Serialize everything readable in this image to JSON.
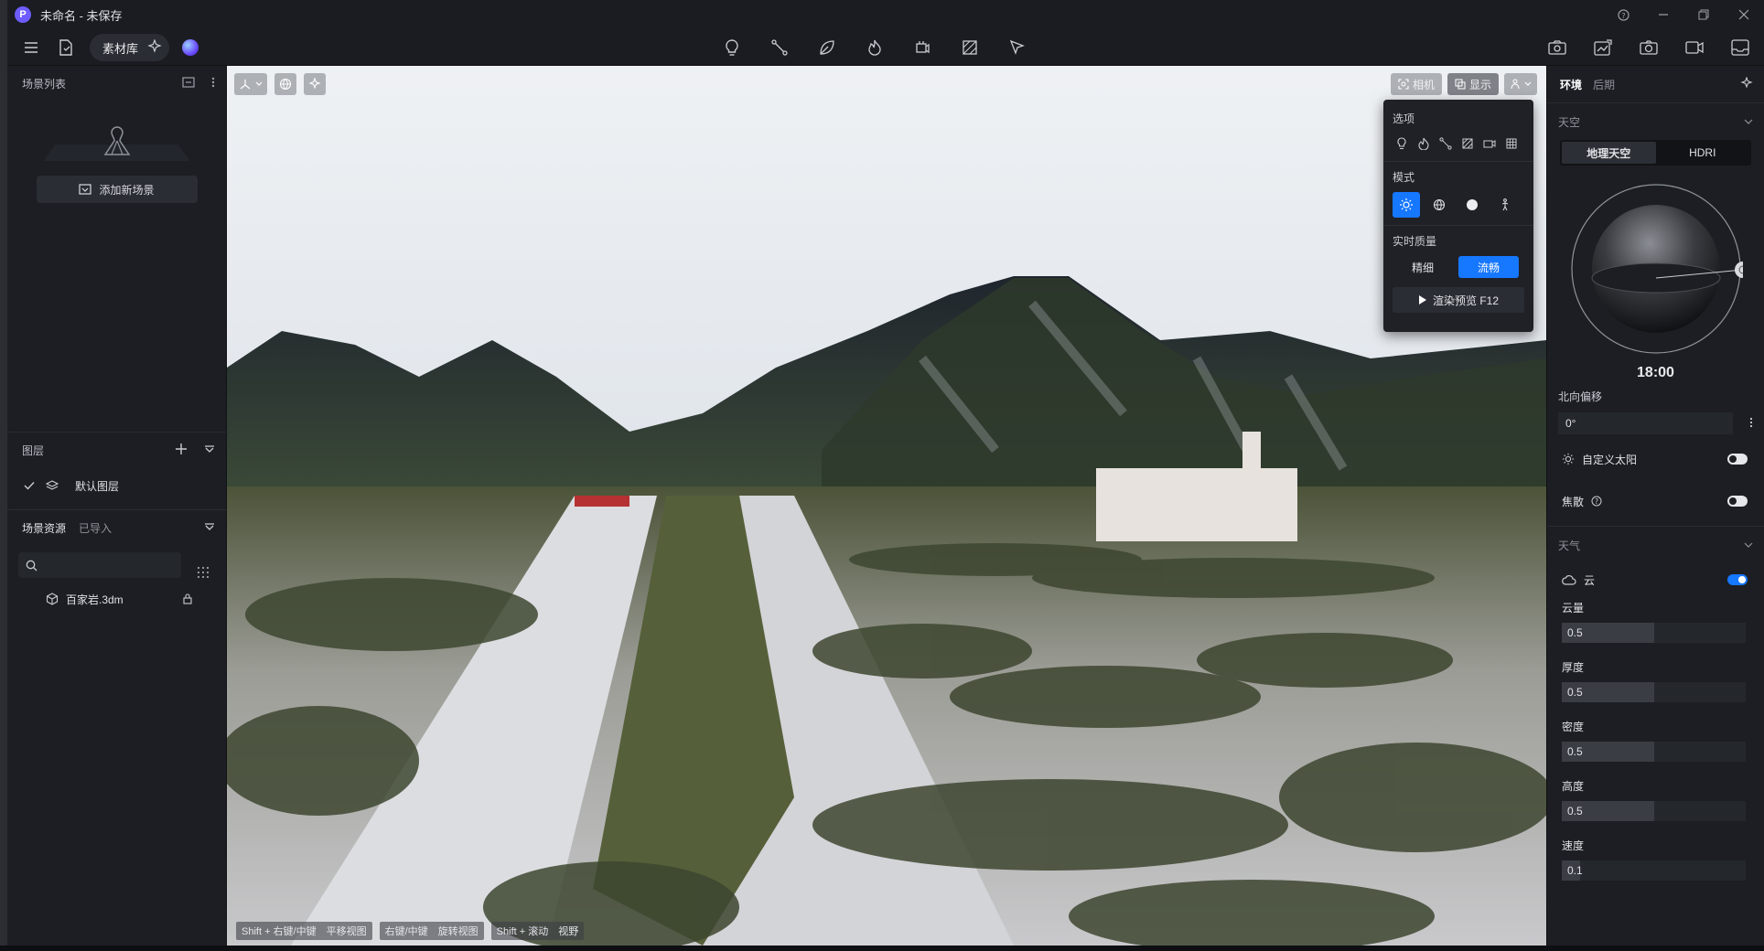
{
  "window": {
    "title": "未命名 - 未保存",
    "logo_letter": "P"
  },
  "toolbar": {
    "asset_library_label": "素材库",
    "center_icons": [
      "lightbulb-icon",
      "path-icon",
      "leaf-icon",
      "flame-icon",
      "crop-icon",
      "texture-icon",
      "pointer-icon"
    ],
    "right_icons": [
      "render-camera-icon",
      "export-icon",
      "camera-icon",
      "video-icon",
      "inbox-icon"
    ]
  },
  "left_panel": {
    "scene_list_title": "场景列表",
    "add_scene_label": "添加新场景",
    "layers_title": "图层",
    "default_layer_label": "默认图层",
    "scene_assets_title": "场景资源",
    "imported_label": "已导入",
    "search_placeholder": "",
    "assets": [
      {
        "name": "百家岩.3dm"
      }
    ]
  },
  "viewport": {
    "camera_label": "相机",
    "display_label": "显示",
    "hints": [
      "Shift + 右键/中键　平移视图",
      "右键/中键　旋转视图",
      "Shift + 滚动　视野"
    ]
  },
  "display_menu": {
    "options_title": "选项",
    "mode_title": "模式",
    "quality_title": "实时质量",
    "quality_fine": "精细",
    "quality_smooth": "流畅",
    "render_preview_label": "渲染预览 F12",
    "selected_quality": "流畅",
    "selected_mode": "sun-icon"
  },
  "right_panel": {
    "tab_environment": "环境",
    "tab_post": "后期",
    "sky_title": "天空",
    "sky_geo": "地理天空",
    "sky_hdri": "HDRI",
    "time": "18:00",
    "north_offset_label": "北向偏移",
    "north_offset_value": "0°",
    "custom_sun_label": "自定义太阳",
    "custom_sun_on": false,
    "caustics_label": "焦散",
    "caustics_on": false,
    "weather_title": "天气",
    "cloud_label": "云",
    "cloud_on": true,
    "cloud_amount_label": "云量",
    "cloud_amount": "0.5",
    "thickness_label": "厚度",
    "thickness": "0.5",
    "density_label": "密度",
    "density": "0.5",
    "height_label": "高度",
    "height": "0.5",
    "speed_label": "速度",
    "speed": "0.1",
    "accent_color": "#1677ff"
  }
}
